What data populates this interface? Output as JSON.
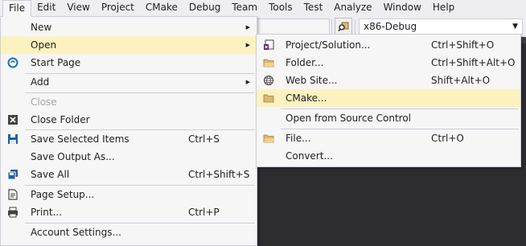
{
  "menubar": {
    "items": [
      "File",
      "Edit",
      "View",
      "Project",
      "CMake",
      "Debug",
      "Team",
      "Tools",
      "Test",
      "Analyze",
      "Window",
      "Help"
    ]
  },
  "toolbar": {
    "platform": "x86-Debug"
  },
  "file_menu": {
    "new": "New",
    "open": "Open",
    "start_page": "Start Page",
    "add": "Add",
    "close": "Close",
    "close_folder": "Close Folder",
    "save_selected": "Save Selected Items",
    "save_selected_shortcut": "Ctrl+S",
    "save_output": "Save Output As...",
    "save_all": "Save All",
    "save_all_shortcut": "Ctrl+Shift+S",
    "page_setup": "Page Setup...",
    "print": "Print...",
    "print_shortcut": "Ctrl+P",
    "account_settings": "Account Settings..."
  },
  "open_menu": {
    "project_solution": "Project/Solution...",
    "project_solution_shortcut": "Ctrl+Shift+O",
    "folder": "Folder...",
    "folder_shortcut": "Ctrl+Shift+Alt+O",
    "web_site": "Web Site...",
    "web_site_shortcut": "Shift+Alt+O",
    "cmake": "CMake...",
    "source_control": "Open from Source Control",
    "file": "File...",
    "file_shortcut": "Ctrl+O",
    "convert": "Convert..."
  },
  "colors": {
    "highlight": "#fcf2c0",
    "menu_bg": "#f6f6f6",
    "editor_bg": "#2d2d30"
  }
}
